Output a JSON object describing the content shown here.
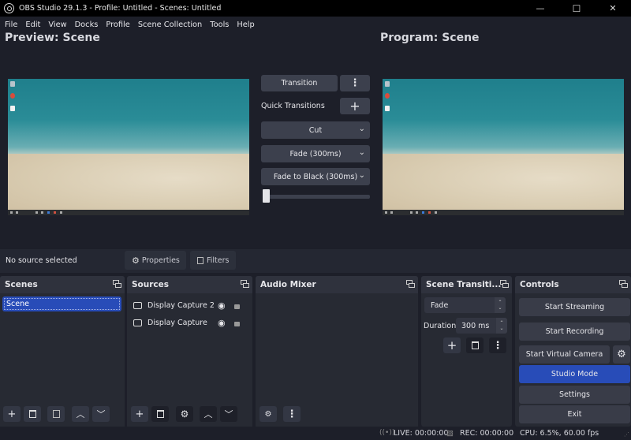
{
  "window": {
    "title": "OBS Studio 29.1.3 - Profile: Untitled - Scenes: Untitled",
    "minimize": "—",
    "maximize": "☐",
    "close": "✕"
  },
  "menu": [
    "File",
    "Edit",
    "View",
    "Docks",
    "Profile",
    "Scene Collection",
    "Tools",
    "Help"
  ],
  "preview": {
    "title": "Preview: Scene"
  },
  "program": {
    "title": "Program: Scene"
  },
  "transition_panel": {
    "transition_label": "Transition",
    "more_icon": "⋮",
    "quick_transitions_label": "Quick Transitions",
    "add_icon": "+",
    "quick_list": [
      "Cut",
      "Fade (300ms)",
      "Fade to Black (300ms)"
    ],
    "chevron": "⌄",
    "tbar_position": 0
  },
  "source_toolbar": {
    "status": "No source selected",
    "properties_label": "Properties",
    "filters_label": "Filters"
  },
  "docks": {
    "scenes": {
      "title": "Scenes",
      "items": [
        "Scene"
      ],
      "selected": "Scene"
    },
    "sources": {
      "title": "Sources",
      "items": [
        {
          "name": "Display Capture 2",
          "visible": true,
          "locked": false
        },
        {
          "name": "Display Capture",
          "visible": true,
          "locked": false
        }
      ]
    },
    "audio_mixer": {
      "title": "Audio Mixer"
    },
    "scene_transitions": {
      "title": "Scene Transiti...",
      "transition": "Fade",
      "duration_label": "Duration",
      "duration_value": "300 ms"
    },
    "controls": {
      "title": "Controls",
      "start_streaming": "Start Streaming",
      "start_recording": "Start Recording",
      "start_virtual_camera": "Start Virtual Camera",
      "studio_mode": "Studio Mode",
      "settings": "Settings",
      "exit": "Exit"
    }
  },
  "status": {
    "live": "LIVE: 00:00:00",
    "rec": "REC: 00:00:00",
    "cpu": "CPU: 6.5%, 60.00 fps"
  },
  "colors": {
    "accent": "#284cb8",
    "background": "#1d1f29",
    "panel": "#272a33",
    "button": "#3c404d"
  }
}
